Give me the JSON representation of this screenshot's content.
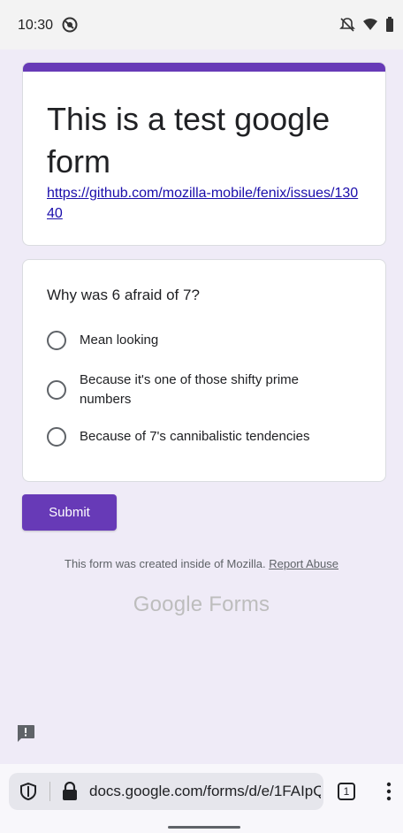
{
  "status_bar": {
    "time": "10:30"
  },
  "form": {
    "title": "This is a test google form",
    "link": "https://github.com/mozilla-mobile/fenix/issues/13040",
    "question": "Why was 6 afraid of 7?",
    "options": [
      "Mean looking",
      "Because it's one of those shifty prime numbers",
      "Because of 7's cannibalistic tendencies"
    ],
    "submit_label": "Submit",
    "footer_text": "This form was created inside of Mozilla.",
    "report_label": "Report Abuse",
    "brand_google": "Google",
    "brand_forms": "Forms"
  },
  "toolbar": {
    "url": "docs.google.com/forms/d/e/1FAIpQ",
    "tab_count": "1"
  },
  "colors": {
    "accent": "#673ab7",
    "background": "#efebf7"
  },
  "icons": {
    "status_left": "dnd-circle-icon",
    "status_right": [
      "notifications-off-icon",
      "wifi-icon",
      "battery-icon"
    ],
    "feedback": "feedback-icon",
    "shield": "shield-icon",
    "lock": "lock-icon",
    "menu": "more-vert-icon"
  }
}
